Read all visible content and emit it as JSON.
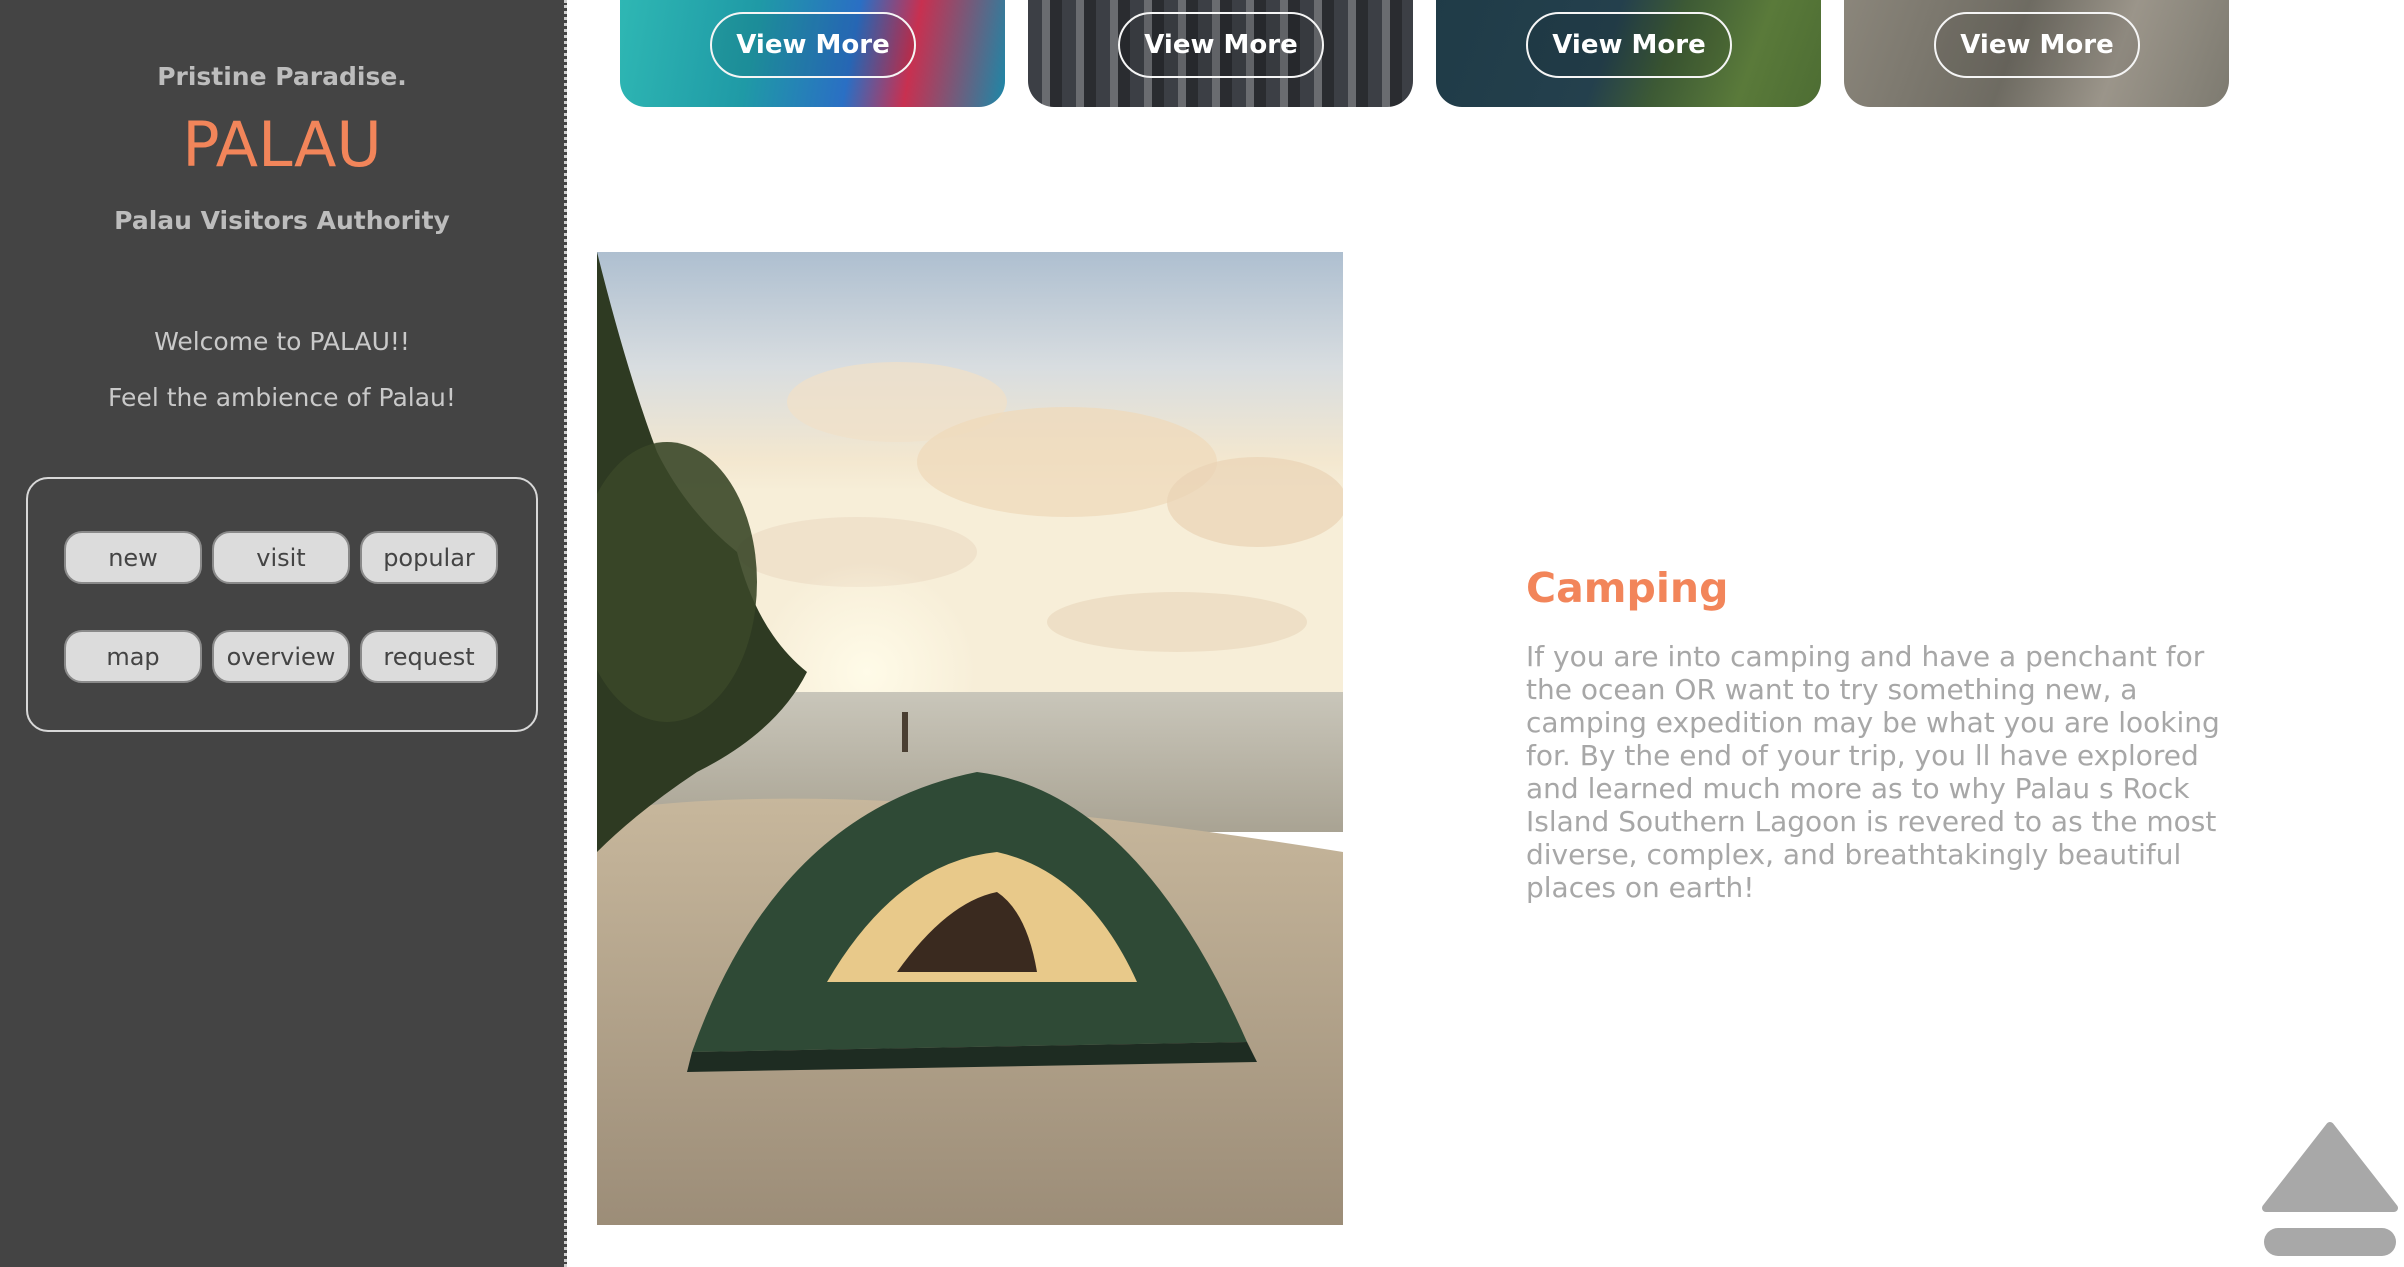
{
  "sidebar": {
    "tagline": "Pristine Paradise.",
    "title": "PALAU",
    "authority": "Palau Visitors Authority",
    "welcome": "Welcome to PALAU!!",
    "ambience": "Feel the ambience of Palau!",
    "nav": {
      "new": "new",
      "visit": "visit",
      "popular": "popular",
      "map": "map",
      "overview": "overview",
      "request": "request"
    }
  },
  "cards": [
    {
      "button": "View More"
    },
    {
      "button": "View More"
    },
    {
      "button": "View More"
    },
    {
      "button": "View More"
    }
  ],
  "feature": {
    "title": "Camping",
    "text": "If you are into camping and have a penchant for the ocean OR want to try something new, a camping expedition may be what you are looking for. By the end of your trip, you   ll have explored and learned much more as to why Palau   s Rock Island Southern Lagoon is revered to as the most diverse, complex, and breathtakingly beautiful places on earth!"
  },
  "colors": {
    "sidebar_bg": "#444444",
    "accent": "#f2855a",
    "muted_text": "#a7a7a7"
  },
  "icons": {
    "scroll_top": "arrow-up-icon"
  }
}
